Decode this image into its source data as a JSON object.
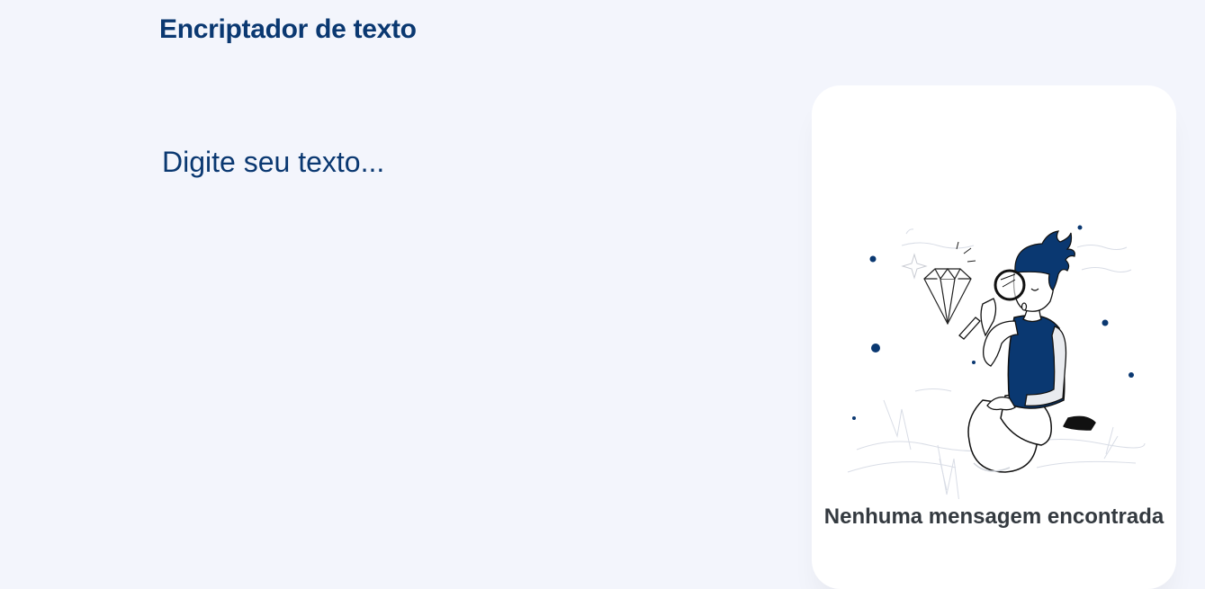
{
  "header": {
    "title": "Encriptador de texto"
  },
  "input": {
    "placeholder": "Digite seu texto..."
  },
  "result_panel": {
    "illustration": "person-searching-diamond-illustration",
    "empty_message": "Nenhuma mensagem encontrada"
  },
  "colors": {
    "brand": "#0a3871",
    "background": "#f3f5fc",
    "panel": "#ffffff",
    "message_text": "#343a40"
  }
}
